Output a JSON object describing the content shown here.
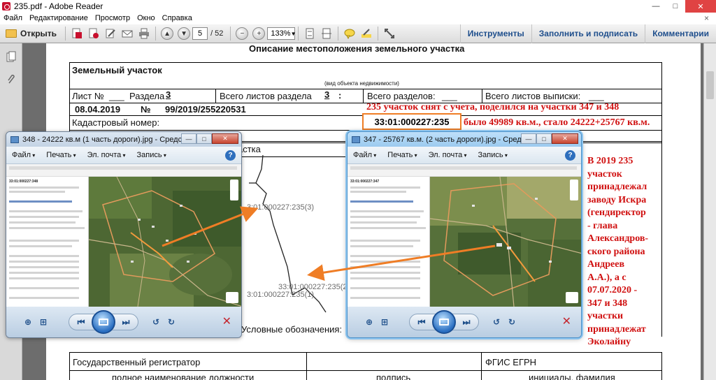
{
  "window": {
    "title": "235.pdf - Adobe Reader",
    "controls": {
      "minimize": "—",
      "maximize": "□",
      "close": "✕"
    }
  },
  "menu": {
    "items": [
      "Файл",
      "Редактирование",
      "Просмотр",
      "Окно",
      "Справка"
    ],
    "close": "×"
  },
  "toolbar": {
    "open_label": "Открыть",
    "page_current": "5",
    "page_total": "/ 52",
    "zoom": "133%",
    "right_links": [
      "Инструменты",
      "Заполнить и подписать",
      "Комментарии"
    ]
  },
  "document": {
    "title": "Описание местоположения земельного участка",
    "object_type": "Земельный участок",
    "object_type_note": "(вид объекта недвижимости)",
    "sheet_row": {
      "sheet": "Лист №",
      "section": "Раздела",
      "section_num": "3",
      "total_sheets_label": "Всего листов раздела",
      "total_sheets_num": "3",
      "colon": ":",
      "total_sections": "Всего разделов:",
      "total_extract": "Всего листов выписки:"
    },
    "date": "08.04.2019",
    "number_sign": "№",
    "number": "99/2019/255220531",
    "cadastral_label": "Кадастровый номер:",
    "cadastral_number": "33:01:000227:235",
    "scheme_label_partial": "астка",
    "legend_label": "Условные обозначения:",
    "map_labels": [
      "3:01:000227:235(3)",
      "33:01:000227:235(2)",
      "3:01:000227:235(1)"
    ],
    "footer": {
      "registrar": "Государственный регистратор",
      "fgis": "ФГИС ЕГРН",
      "position": "полное наименование должности",
      "signature": "подпись",
      "initials": "инициалы, фамилия"
    }
  },
  "annotations": {
    "red_line1": "235 участок снят с учета, поделился на участки 347 и 348",
    "red_line2": "было 49989 кв.м., стало 24222+25767 кв.м.",
    "red_side": [
      "В 2019 235",
      "участок",
      "принадлежал",
      "заводу Искра",
      "(гендиректор",
      "- глава",
      "Александров-",
      "ского района",
      "Андреев",
      "А.А.), а с",
      "07.07.2020 -",
      "347 и 348",
      "участки",
      "принадлежат",
      "Эколайну"
    ],
    "accent_color": "#ef7d25",
    "red_color": "#d01010"
  },
  "viewer_left": {
    "title": "348 - 24222 кв.м (1 часть дороги).jpg - Средство ...",
    "menu": [
      "Файл",
      "Печать",
      "Эл. почта",
      "Запись"
    ],
    "help": "?",
    "shot_header": "33:01:000227:348"
  },
  "viewer_right": {
    "title": "347 - 25767 кв.м. (2 часть дороги).jpg - Средство ...",
    "menu": [
      "Файл",
      "Печать",
      "Эл. почта",
      "Запись"
    ],
    "help": "?",
    "shot_header": "33:01:000227:347"
  }
}
